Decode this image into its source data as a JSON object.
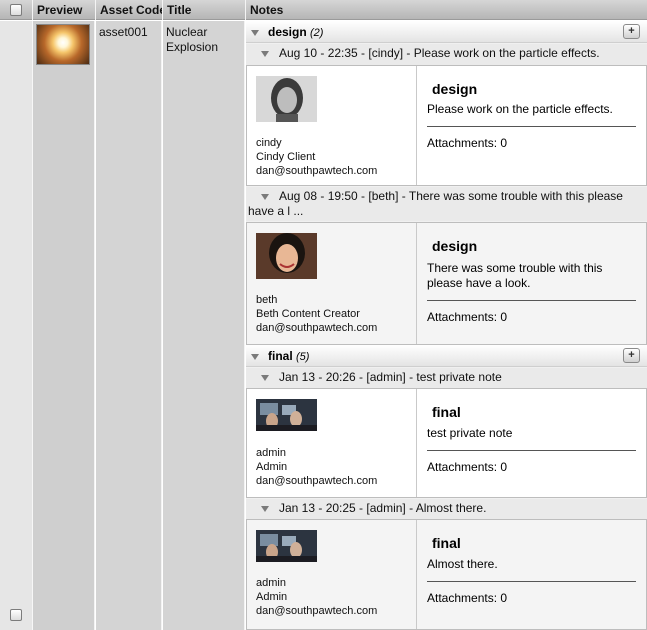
{
  "columns": {
    "preview": "Preview",
    "asset_code": "Asset Code",
    "title": "Title",
    "notes": "Notes"
  },
  "row": {
    "asset_code": "asset001",
    "title": "Nuclear Explosion"
  },
  "icons": {
    "collapse": "triangle-down-icon",
    "add": "plus-icon"
  },
  "contexts": [
    {
      "name": "design",
      "count": "(2)",
      "notes": [
        {
          "header": "Aug 10 - 22:35 - [cindy] - Please work on the particle effects.",
          "login": "cindy",
          "display_name": "Cindy Client",
          "email": "dan@southpawtech.com",
          "context": "design",
          "text": "Please work on the particle effects.",
          "attachments": "Attachments: 0"
        },
        {
          "header": "Aug 08 - 19:50 - [beth] - There was some trouble with this please have a l ...",
          "login": "beth",
          "display_name": "Beth Content Creator",
          "email": "dan@southpawtech.com",
          "context": "design",
          "text": "There was some trouble with this please have a look.",
          "attachments": "Attachments: 0"
        }
      ]
    },
    {
      "name": "final",
      "count": "(5)",
      "notes": [
        {
          "header": "Jan 13 - 20:26 - [admin] - test private note",
          "login": "admin",
          "display_name": "Admin",
          "email": "dan@southpawtech.com",
          "context": "final",
          "text": "test private note",
          "attachments": "Attachments: 0"
        },
        {
          "header": "Jan 13 - 20:25 - [admin] - Almost there.",
          "login": "admin",
          "display_name": "Admin",
          "email": "dan@southpawtech.com",
          "context": "final",
          "text": "Almost there.",
          "attachments": "Attachments: 0"
        }
      ]
    }
  ]
}
